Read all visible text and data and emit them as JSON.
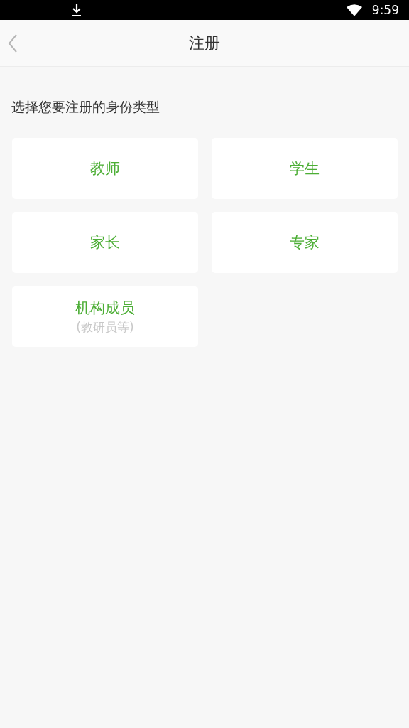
{
  "status_bar": {
    "time": "9:59"
  },
  "header": {
    "title": "注册"
  },
  "prompt": "选择您要注册的身份类型",
  "options": [
    {
      "label": "教师"
    },
    {
      "label": "学生"
    },
    {
      "label": "家长"
    },
    {
      "label": "专家"
    },
    {
      "label": "机构成员",
      "note": "(教研员等)"
    }
  ]
}
